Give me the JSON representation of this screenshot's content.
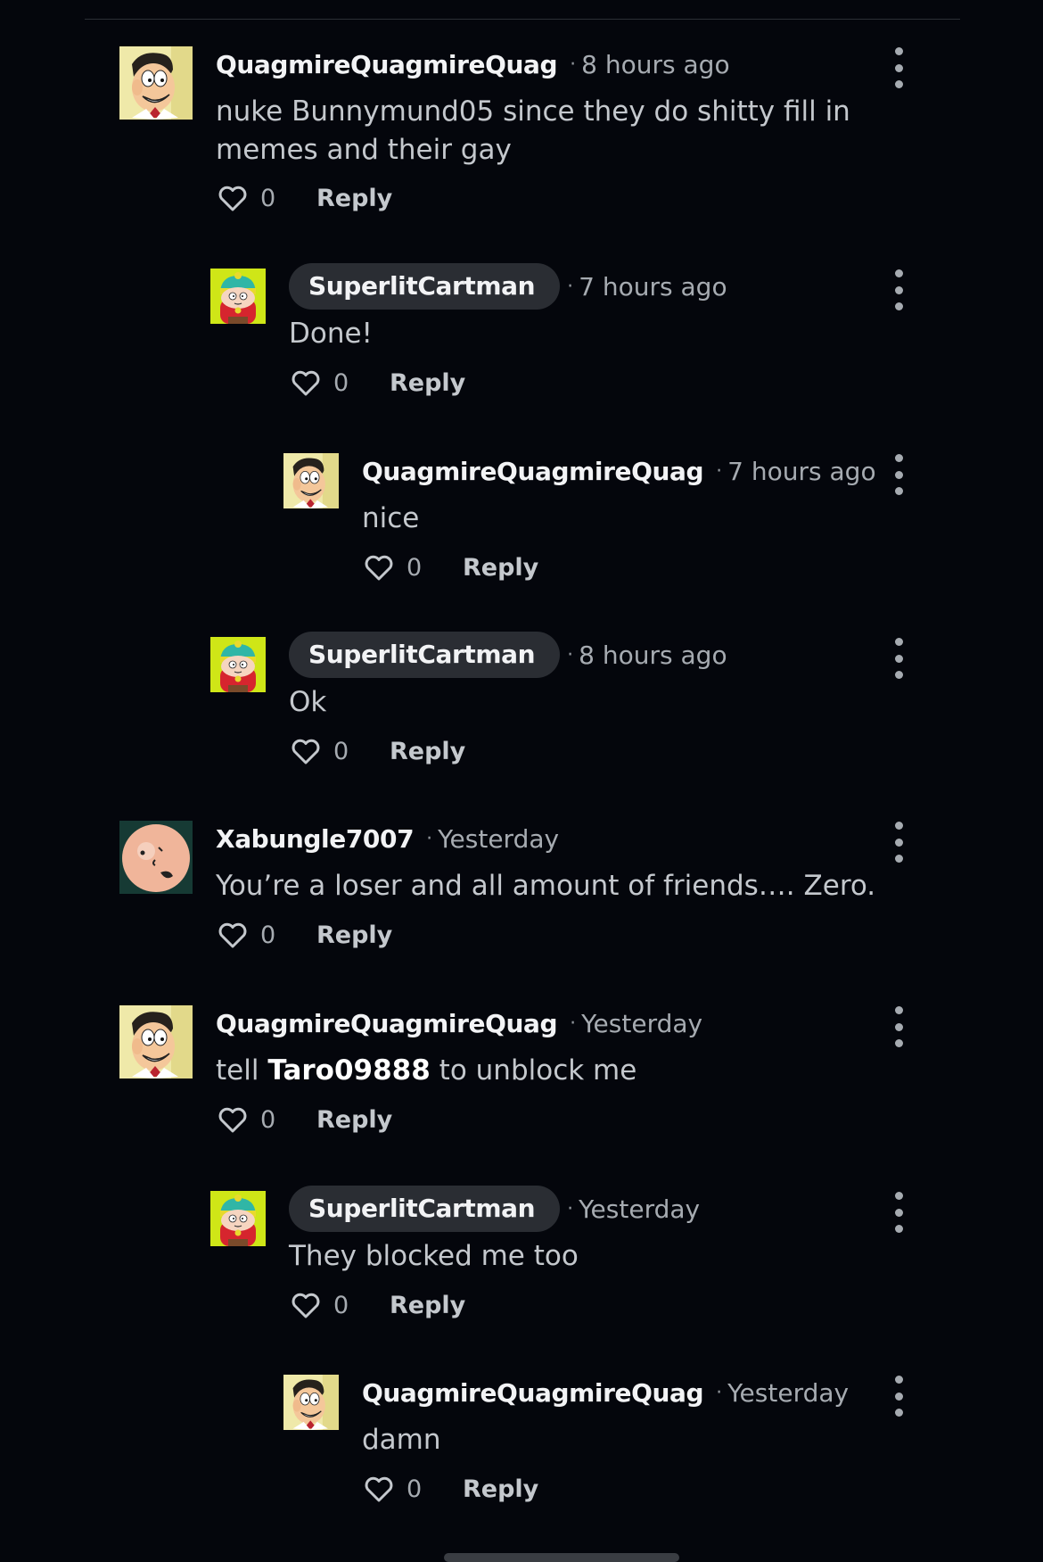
{
  "comments": [
    {
      "author": "QuagmireQuagmireQuag",
      "time": "8 hours ago",
      "lines": [
        "nuke Bunnymund05 since they do shitty fill in",
        "memes and their gay"
      ],
      "likes": "0",
      "reply": "Reply",
      "avatar_icon": "quagmire-avatar"
    },
    {
      "author": "SuperlitCartman",
      "time": "7 hours ago",
      "text": "Done!",
      "likes": "0",
      "reply": "Reply",
      "avatar_icon": "cartman-avatar"
    },
    {
      "author": "QuagmireQuagmireQuag",
      "time": "7 hours ago",
      "text": "nice",
      "likes": "0",
      "reply": "Reply",
      "avatar_icon": "quagmire-avatar"
    },
    {
      "author": "SuperlitCartman",
      "time": "8 hours ago",
      "text": "Ok",
      "likes": "0",
      "reply": "Reply",
      "avatar_icon": "cartman-avatar"
    },
    {
      "author": "Xabungle7007",
      "time": "Yesterday",
      "text": "You’re a loser and all amount of friends…. Zero.",
      "likes": "0",
      "reply": "Reply",
      "avatar_icon": "bald-head-avatar"
    },
    {
      "author": "QuagmireQuagmireQuag",
      "time": "Yesterday",
      "text_before": "tell ",
      "mention": "Taro09888",
      "text_after": " to unblock me",
      "likes": "0",
      "reply": "Reply",
      "avatar_icon": "quagmire-avatar"
    },
    {
      "author": "SuperlitCartman",
      "time": "Yesterday",
      "text": "They blocked me too",
      "likes": "0",
      "reply": "Reply",
      "avatar_icon": "cartman-avatar"
    },
    {
      "author": "QuagmireQuagmireQuag",
      "time": "Yesterday",
      "text": "damn",
      "likes": "0",
      "reply": "Reply",
      "avatar_icon": "quagmire-avatar"
    }
  ],
  "colors": {
    "background": "#04060c",
    "author_pill": "#2a2d33",
    "cartman_bg": "#cfe617"
  }
}
